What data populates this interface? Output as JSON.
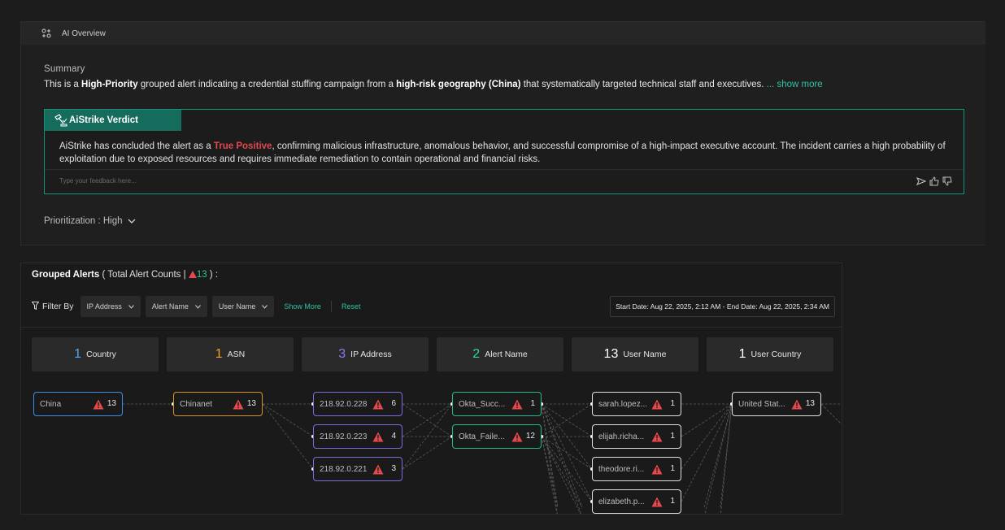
{
  "ai_overview": {
    "header_title": "AI Overview",
    "summary_label": "Summary",
    "summary": {
      "p1": "This is a ",
      "b1": "High-Priority",
      "p2": " grouped alert indicating a credential stuffing campaign from a ",
      "b2": "high-risk geography (China)",
      "p3": " that systematically targeted technical staff and executives.",
      "show_more": " ... show more"
    },
    "verdict_title": "AiStrike Verdict",
    "verdict": {
      "p1": "AiStrike has concluded the alert as a ",
      "tp": "True Positive",
      "p2": ", confirming malicious infrastructure, anomalous behavior, and successful compromise of a high-impact executive account. The incident carries a high probability of exploitation due to exposed resources and requires immediate remediation to contain operational and financial risks."
    },
    "feedback_placeholder": "Type your feedback here...",
    "prioritization": "Prioritization : High"
  },
  "grouped_alerts": {
    "title": "Grouped Alerts",
    "total_prefix": " ( Total Alert Counts  |  ",
    "total_count": "13",
    "total_suffix": " ) :",
    "filter_label": "Filter By",
    "filters": [
      "IP Address",
      "Alert Name",
      "User Name"
    ],
    "show_more": "Show More",
    "reset": "Reset",
    "date_range": "Start Date: Aug 22, 2025, 2:12 AM - End Date: Aug 22, 2025, 2:34 AM",
    "stats": [
      {
        "num": "1",
        "label": "Country",
        "color": "#4aa8ff"
      },
      {
        "num": "1",
        "label": "ASN",
        "color": "#f0a020"
      },
      {
        "num": "3",
        "label": "IP Address",
        "color": "#8a7cf0"
      },
      {
        "num": "2",
        "label": "Alert Name",
        "color": "#2dd4a8"
      },
      {
        "num": "13",
        "label": "User Name",
        "color": "#ffffff"
      },
      {
        "num": "1",
        "label": "User Country",
        "color": "#ffffff"
      }
    ],
    "nodes": {
      "country": [
        {
          "label": "China",
          "count": "13"
        }
      ],
      "asn": [
        {
          "label": "Chinanet",
          "count": "13"
        }
      ],
      "ip": [
        {
          "label": "218.92.0.228",
          "count": "6"
        },
        {
          "label": "218.92.0.223",
          "count": "4"
        },
        {
          "label": "218.92.0.221",
          "count": "3"
        }
      ],
      "alert": [
        {
          "label": "Okta_Succ...",
          "count": "1"
        },
        {
          "label": "Okta_Faile...",
          "count": "12"
        }
      ],
      "user": [
        {
          "label": "sarah.lopez...",
          "count": "1"
        },
        {
          "label": "elijah.richa...",
          "count": "1"
        },
        {
          "label": "theodore.ri...",
          "count": "1"
        },
        {
          "label": "elizabeth.p...",
          "count": "1"
        }
      ],
      "user_country": [
        {
          "label": "United Stat...",
          "count": "13"
        }
      ]
    },
    "colors": {
      "country": "#3a8ee6",
      "asn": "#d9921c",
      "ip": "#7a6cdc",
      "alert": "#22b893",
      "user": "#e0e0e0",
      "user_country": "#e0e0e0",
      "warn": "#e5484d"
    }
  }
}
